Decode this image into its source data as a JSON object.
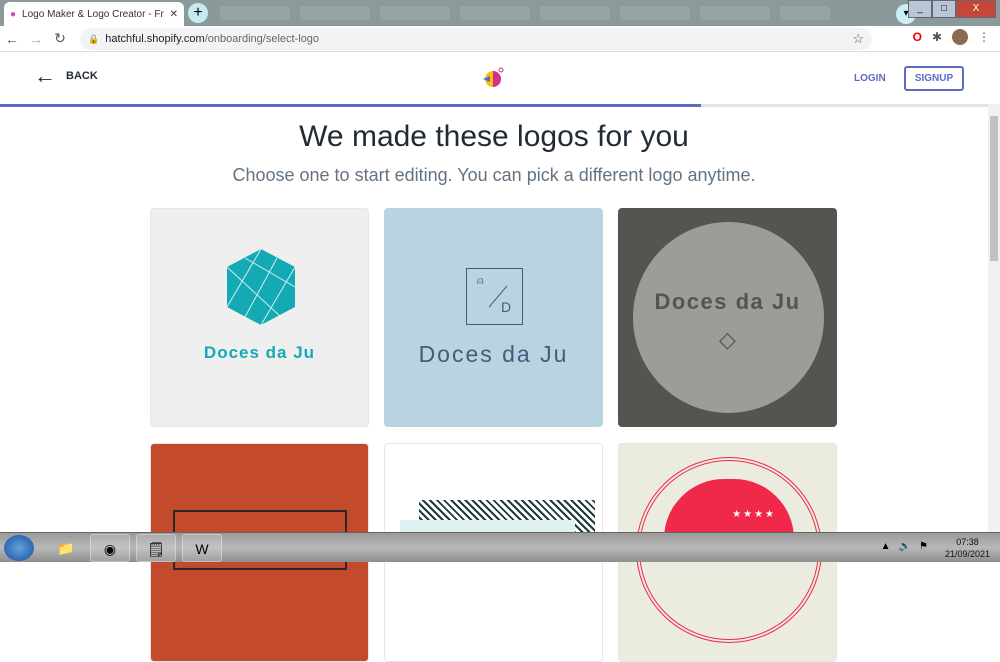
{
  "browser": {
    "tab_title": "Logo Maker & Logo Creator - Fre",
    "url_host": "hatchful.shopify.com",
    "url_path": "/onboarding/select-logo"
  },
  "header": {
    "back_label": "BACK",
    "login_label": "LOGIN",
    "signup_label": "SIGNUP",
    "progress_percent": 71
  },
  "main": {
    "title": "We made these logos for you",
    "subtitle": "Choose one to start editing. You can pick a different logo anytime."
  },
  "logos": [
    {
      "name": "Doces da Ju",
      "color": "#13aab4"
    },
    {
      "name": "Doces da Ju",
      "monogram": "D",
      "color": "#475a7a"
    },
    {
      "name": "Doces da Ju",
      "color": "#545550"
    }
  ],
  "taskbar": {
    "time": "07:38",
    "date": "21/09/2021"
  }
}
